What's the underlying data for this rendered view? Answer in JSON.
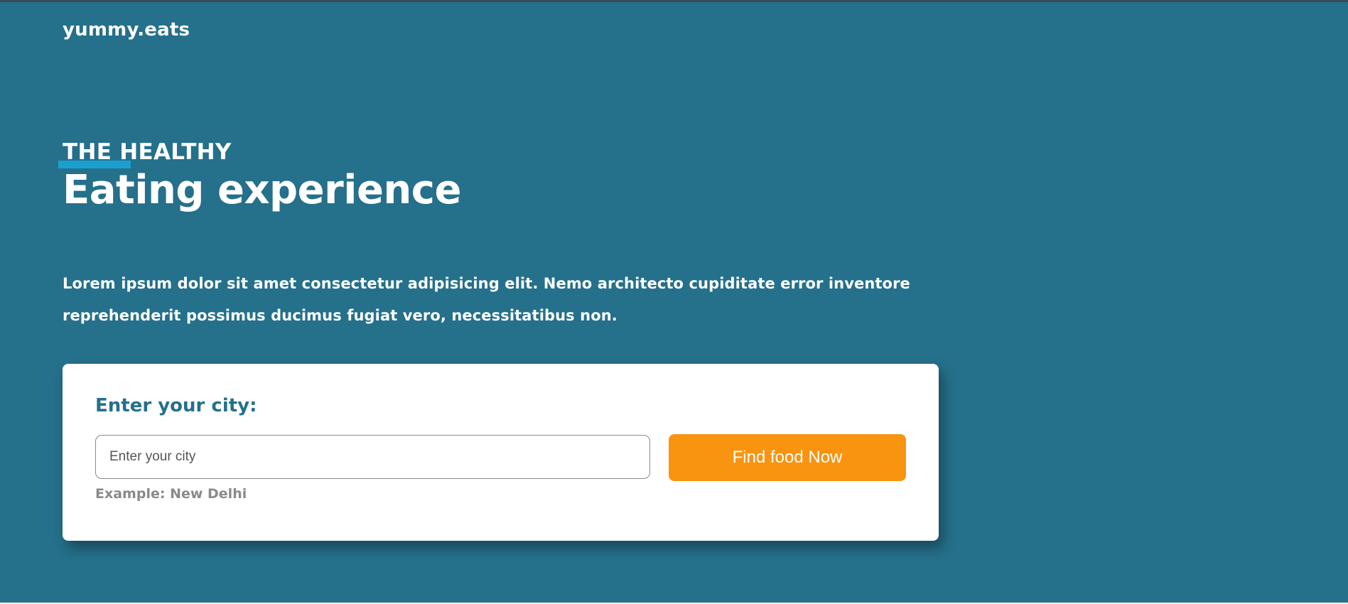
{
  "header": {
    "logo": "yummy.eats"
  },
  "hero": {
    "subtitle": "THE HEALTHY",
    "headline": "Eating experience",
    "description": "Lorem ipsum dolor sit amet consectetur adipisicing elit. Nemo architecto cupiditate error inventore reprehenderit possimus ducimus fugiat vero, necessitatibus non."
  },
  "search_card": {
    "label": "Enter your city:",
    "input_placeholder": "Enter your city",
    "input_value": "",
    "button_label": "Find food Now",
    "hint": "Example: New Delhi"
  },
  "colors": {
    "background": "#25708b",
    "accent_highlight": "#1aa0d0",
    "button": "#f89410",
    "card": "#ffffff",
    "label": "#25708b"
  }
}
